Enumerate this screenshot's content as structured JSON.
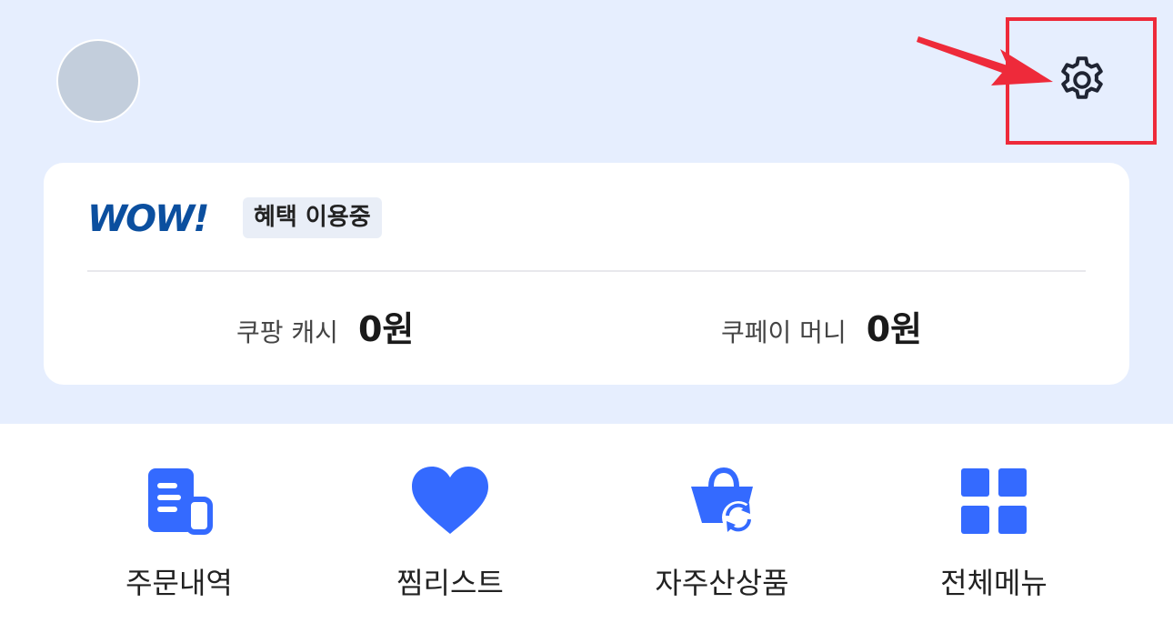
{
  "header": {
    "avatar_alt": "",
    "settings_icon": "gear-icon"
  },
  "card": {
    "logo_text": "WOW!",
    "badge": "혜택 이용중",
    "balances": [
      {
        "label": "쿠팡 캐시",
        "value": "0원"
      },
      {
        "label": "쿠페이 머니",
        "value": "0원"
      }
    ]
  },
  "menu": [
    {
      "label": "주문내역",
      "icon": "receipt-icon"
    },
    {
      "label": "찜리스트",
      "icon": "heart-icon"
    },
    {
      "label": "자주산상품",
      "icon": "reorder-bag-icon"
    },
    {
      "label": "전체메뉴",
      "icon": "grid-icon"
    }
  ],
  "colors": {
    "accent": "#346aff",
    "highlight": "#ee2a3a",
    "header_bg": "#e6eefe",
    "wow_blue": "#0b4f9f"
  }
}
